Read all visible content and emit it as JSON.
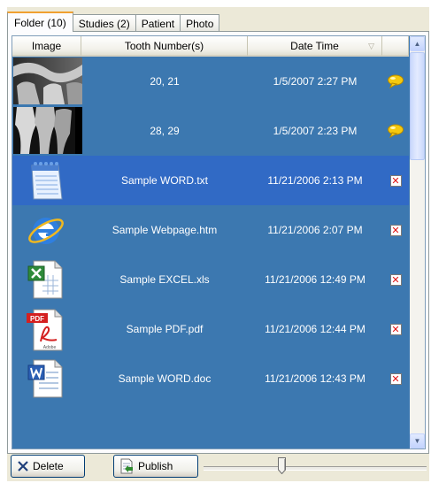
{
  "tabs": [
    {
      "label": "Folder (10)",
      "active": true
    },
    {
      "label": "Studies (2)",
      "active": false
    },
    {
      "label": "Patient",
      "active": false
    },
    {
      "label": "Photo",
      "active": false
    }
  ],
  "columns": {
    "image": "Image",
    "tooth": "Tooth Number(s)",
    "date": "Date Time"
  },
  "rows": [
    {
      "icon": "xray-image-icon",
      "name": "20, 21",
      "date": "1/5/2007 2:27 PM",
      "flag": "comment-icon"
    },
    {
      "icon": "xray-image-icon",
      "name": "28, 29",
      "date": "1/5/2007 2:23 PM",
      "flag": "comment-icon"
    },
    {
      "icon": "notepad-file-icon",
      "name": "Sample WORD.txt",
      "date": "11/21/2006 2:13 PM",
      "flag": "delete-icon",
      "selected": true
    },
    {
      "icon": "internet-explorer-file-icon",
      "name": "Sample Webpage.htm",
      "date": "11/21/2006 2:07 PM",
      "flag": "delete-icon"
    },
    {
      "icon": "excel-file-icon",
      "name": "Sample EXCEL.xls",
      "date": "11/21/2006 12:49 PM",
      "flag": "delete-icon"
    },
    {
      "icon": "pdf-file-icon",
      "name": "Sample PDF.pdf",
      "date": "11/21/2006 12:44 PM",
      "flag": "delete-icon"
    },
    {
      "icon": "word-file-icon",
      "name": "Sample WORD.doc",
      "date": "11/21/2006 12:43 PM",
      "flag": "delete-icon"
    }
  ],
  "toolbar": {
    "delete_label": "Delete",
    "publish_label": "Publish"
  },
  "pdf_icon_text": "PDF",
  "adobe_icon_text": "Adobe",
  "colors": {
    "grid_bg": "#3c78b0",
    "selected_row": "#316ac5",
    "delete_red": "#e01010",
    "comment_yellow": "#f6c90e"
  }
}
